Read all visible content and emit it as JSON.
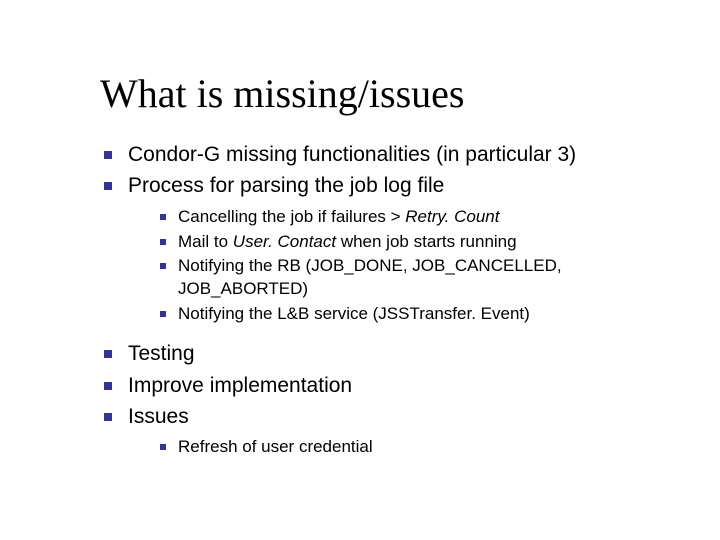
{
  "title": "What is missing/issues",
  "bullets": {
    "b1": "Condor-G missing functionalities (in particular 3)",
    "b2": "Process for parsing the job log file",
    "b2_sub": {
      "s1a": "Cancelling the job if failures > ",
      "s1b": "Retry. Count",
      "s2a": "Mail to ",
      "s2b": "User. Contact",
      "s2c": " when job starts running",
      "s3": "Notifying the RB (JOB_DONE, JOB_CANCELLED, JOB_ABORTED)",
      "s4": "Notifying the L&B service (JSSTransfer. Event)"
    },
    "b3": "Testing",
    "b4": "Improve implementation",
    "b5": "Issues",
    "b5_sub": {
      "s1": "Refresh of user credential"
    }
  },
  "colors": {
    "bullet": "#33339a"
  }
}
